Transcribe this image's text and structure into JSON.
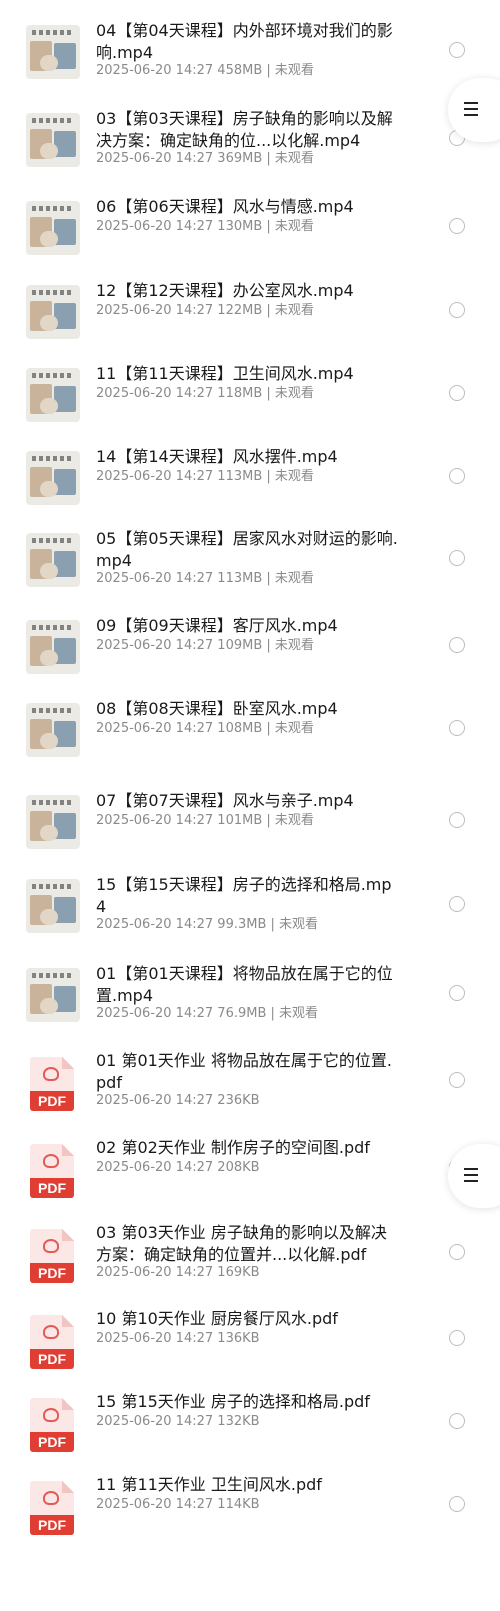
{
  "files": [
    {
      "title": "04【第04天课程】内外部环境对我们的影响.mp4",
      "date": "2025-06-20 14:27",
      "size": "458MB",
      "status": "未观看",
      "type": "video",
      "thumb_icon": "video-thumbnail"
    },
    {
      "title": "03【第03天课程】房子缺角的影响以及解决方案：确定缺角的位...以化解.mp4",
      "date": "2025-06-20 14:27",
      "size": "369MB",
      "status": "未观看",
      "type": "video",
      "thumb_icon": "video-thumbnail"
    },
    {
      "title": "06【第06天课程】风水与情感.mp4",
      "date": "2025-06-20 14:27",
      "size": "130MB",
      "status": "未观看",
      "type": "video",
      "thumb_icon": "video-thumbnail"
    },
    {
      "title": "12【第12天课程】办公室风水.mp4",
      "date": "2025-06-20 14:27",
      "size": "122MB",
      "status": "未观看",
      "type": "video",
      "thumb_icon": "video-thumbnail"
    },
    {
      "title": "11【第11天课程】卫生间风水.mp4",
      "date": "2025-06-20 14:27",
      "size": "118MB",
      "status": "未观看",
      "type": "video",
      "thumb_icon": "video-thumbnail"
    },
    {
      "title": "14【第14天课程】风水摆件.mp4",
      "date": "2025-06-20 14:27",
      "size": "113MB",
      "status": "未观看",
      "type": "video",
      "thumb_icon": "video-thumbnail"
    },
    {
      "title": "05【第05天课程】居家风水对财运的影响.mp4",
      "date": "2025-06-20 14:27",
      "size": "113MB",
      "status": "未观看",
      "type": "video",
      "thumb_icon": "video-thumbnail"
    },
    {
      "title": "09【第09天课程】客厅风水.mp4",
      "date": "2025-06-20 14:27",
      "size": "109MB",
      "status": "未观看",
      "type": "video",
      "thumb_icon": "video-thumbnail"
    },
    {
      "title": "08【第08天课程】卧室风水.mp4",
      "date": "2025-06-20 14:27",
      "size": "108MB",
      "status": "未观看",
      "type": "video",
      "thumb_icon": "video-thumbnail"
    },
    {
      "title": "07【第07天课程】风水与亲子.mp4",
      "date": "2025-06-20 14:27",
      "size": "101MB",
      "status": "未观看",
      "type": "video",
      "thumb_icon": "video-thumbnail"
    },
    {
      "title": "15【第15天课程】房子的选择和格局.mp4",
      "date": "2025-06-20 14:27",
      "size": "99.3MB",
      "status": "未观看",
      "type": "video",
      "thumb_icon": "video-thumbnail"
    },
    {
      "title": "01【第01天课程】将物品放在属于它的位置.mp4",
      "date": "2025-06-20 14:27",
      "size": "76.9MB",
      "status": "未观看",
      "type": "video",
      "thumb_icon": "video-thumbnail"
    },
    {
      "title": "01 第01天作业 将物品放在属于它的位置.pdf",
      "date": "2025-06-20 14:27",
      "size": "236KB",
      "status": "",
      "type": "pdf",
      "pdf_label": "PDF",
      "thumb_icon": "pdf-file-icon"
    },
    {
      "title": "02 第02天作业 制作房子的空间图.pdf",
      "date": "2025-06-20 14:27",
      "size": "208KB",
      "status": "",
      "type": "pdf",
      "pdf_label": "PDF",
      "thumb_icon": "pdf-file-icon"
    },
    {
      "title": "03 第03天作业 房子缺角的影响以及解决方案：确定缺角的位置并...以化解.pdf",
      "date": "2025-06-20 14:27",
      "size": "169KB",
      "status": "",
      "type": "pdf",
      "pdf_label": "PDF",
      "thumb_icon": "pdf-file-icon"
    },
    {
      "title": "10 第10天作业 厨房餐厅风水.pdf",
      "date": "2025-06-20 14:27",
      "size": "136KB",
      "status": "",
      "type": "pdf",
      "pdf_label": "PDF",
      "thumb_icon": "pdf-file-icon"
    },
    {
      "title": "15 第15天作业 房子的选择和格局.pdf",
      "date": "2025-06-20 14:27",
      "size": "132KB",
      "status": "",
      "type": "pdf",
      "pdf_label": "PDF",
      "thumb_icon": "pdf-file-icon"
    },
    {
      "title": "11 第11天作业 卫生间风水.pdf",
      "date": "2025-06-20 14:27",
      "size": "114KB",
      "status": "",
      "type": "pdf",
      "pdf_label": "PDF",
      "thumb_icon": "pdf-file-icon"
    }
  ],
  "menu_buttons": [
    {
      "icon": "menu-icon"
    },
    {
      "icon": "menu-icon"
    }
  ],
  "colors": {
    "pdf_red": "#e03d33",
    "meta_gray": "#8a8a8a",
    "title_text": "#1a1a1a"
  }
}
